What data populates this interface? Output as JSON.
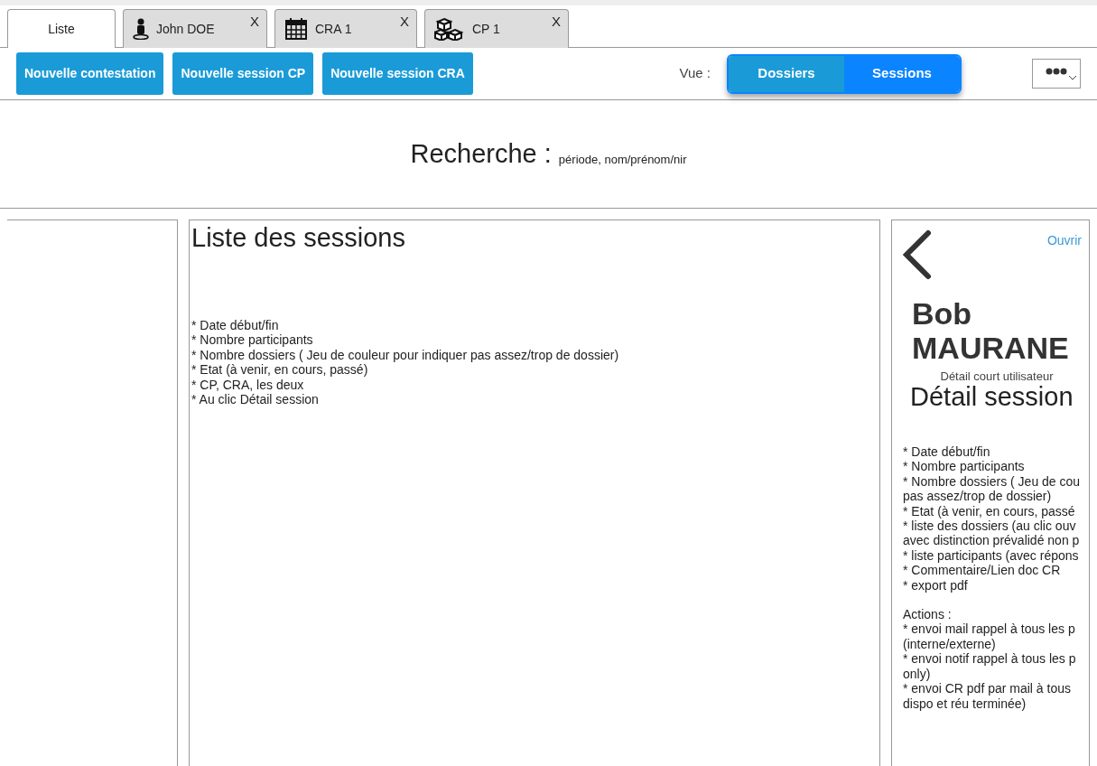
{
  "tabs": [
    {
      "label": "Liste",
      "selected": true,
      "kind": "list"
    },
    {
      "label": "John DOE",
      "selected": false,
      "kind": "person",
      "close": "X"
    },
    {
      "label": "CRA 1",
      "selected": false,
      "kind": "calendar",
      "close": "X"
    },
    {
      "label": "CP 1",
      "selected": false,
      "kind": "cubes",
      "close": "X"
    }
  ],
  "actions": [
    "Nouvelle contestation",
    "Nouvelle session CP",
    "Nouvelle session CRA"
  ],
  "view": {
    "label": "Vue :",
    "options": [
      {
        "label": "Dossiers",
        "selected": false
      },
      {
        "label": "Sessions",
        "selected": true
      }
    ]
  },
  "search": {
    "title": "Recherche :",
    "hint": "période, nom/prénom/nir"
  },
  "list": {
    "title": "Liste des sessions",
    "lines": [
      "* Date début/fin",
      "* Nombre participants",
      "* Nombre dossiers ( Jeu de couleur pour indiquer pas assez/trop de dossier)",
      "* Etat (à venir, en cours, passé)",
      "* CP, CRA, les deux",
      "* Au clic Détail session"
    ]
  },
  "detail": {
    "open_link": "Ouvrir",
    "name_lines": [
      "Bob",
      "MAURANE"
    ],
    "subtitle": "Détail court utilisateur",
    "title": "Détail session",
    "lines": [
      "* Date début/fin",
      "* Nombre participants",
      "* Nombre dossiers ( Jeu de cou",
      "pas assez/trop de dossier)",
      "* Etat (à venir, en cours, passé",
      "* liste des dossiers (au clic ouv",
      "avec distinction prévalidé non p",
      "* liste participants (avec répons",
      "* Commentaire/Lien doc CR",
      "* export pdf"
    ],
    "actions_title": "Actions :",
    "action_lines": [
      "* envoi mail rappel à tous les p",
      "(interne/externe)",
      "* envoi notif rappel à tous les p",
      "only)",
      "* envoi CR pdf par mail à tous",
      "dispo et réu terminée)"
    ]
  }
}
